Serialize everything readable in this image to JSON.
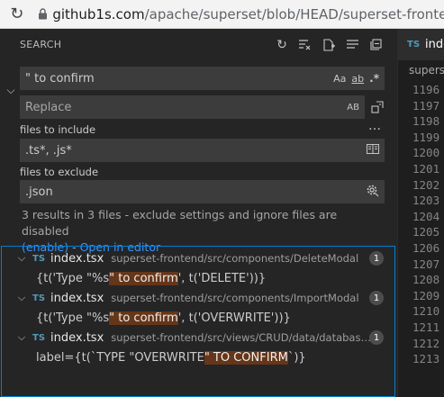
{
  "browser": {
    "url_host": "github1s.com",
    "url_path": "/apache/superset/blob/HEAD/superset-frontend/"
  },
  "search_panel": {
    "title": "SEARCH",
    "search_value": "\" to confirm",
    "replace_placeholder": "Replace",
    "match_case_label": "Aa",
    "whole_word_label": "ab",
    "regex_label": ".*",
    "preserve_case_label": "AB",
    "files_to_include_label": "files to include",
    "files_to_include_value": ".ts*, .js*",
    "files_to_exclude_label": "files to exclude",
    "files_to_exclude_value": ".json",
    "summary_text": "3 results in 3 files - exclude settings and ignore files are disabled",
    "enable_link": "(enable)",
    "separator": " - ",
    "open_in_editor_link": "Open in editor"
  },
  "results": [
    {
      "lang": "TS",
      "file": "index.tsx",
      "path": "superset-frontend/src/components/DeleteModal",
      "count": "1",
      "match_before": "{t('Type \"%s",
      "match_hit": "\" to confirm",
      "match_after": "', t('DELETE'))}"
    },
    {
      "lang": "TS",
      "file": "index.tsx",
      "path": "superset-frontend/src/components/ImportModal",
      "count": "1",
      "match_before": "{t('Type \"%s",
      "match_hit": "\" to confirm",
      "match_after": "', t('OVERWRITE'))}"
    },
    {
      "lang": "TS",
      "file": "index.tsx",
      "path": "superset-frontend/src/views/CRUD/data/database/D...",
      "count": "1",
      "match_before": "label={t(`TYPE \"OVERWRITE",
      "match_hit": "\" TO CONFIRM",
      "match_after": "`)}"
    }
  ],
  "editor": {
    "tab_lang": "TS",
    "tab_label": "inde",
    "breadcrumb": "supers",
    "line_numbers": [
      "1196",
      "1197",
      "1198",
      "1199",
      "1200",
      "1201",
      "1202",
      "1203",
      "1204",
      "1205",
      "1206",
      "1207",
      "1208",
      "1209",
      "1210",
      "1211",
      "1212",
      "1213"
    ]
  }
}
